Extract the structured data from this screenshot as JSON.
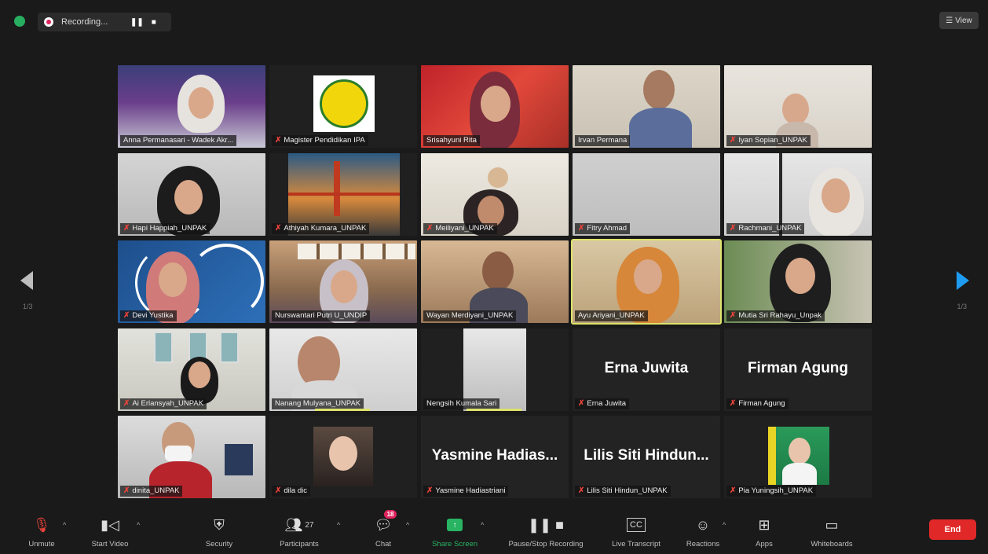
{
  "topbar": {
    "recording_label": "Recording...",
    "pause_glyph": "❚❚",
    "stop_glyph": "■",
    "view_label": "View"
  },
  "nav": {
    "page_left": "1/3",
    "page_right": "1/3"
  },
  "participants": [
    {
      "name": "Anna Permanasari - Wadek Akr...",
      "mic_muted": false,
      "kind": "video"
    },
    {
      "name": "Magister Pendidikan IPA",
      "mic_muted": true,
      "kind": "logo"
    },
    {
      "name": "Srisahyuni Rita",
      "mic_muted": false,
      "kind": "video"
    },
    {
      "name": "Irvan Permana",
      "mic_muted": false,
      "kind": "video"
    },
    {
      "name": "Iyan Sopian_UNPAK",
      "mic_muted": true,
      "kind": "video"
    },
    {
      "name": "Hapi Happiah_UNPAK",
      "mic_muted": true,
      "kind": "video"
    },
    {
      "name": "Athiyah Kumara_UNPAK",
      "mic_muted": true,
      "kind": "image"
    },
    {
      "name": "Meiliyani_UNPAK",
      "mic_muted": true,
      "kind": "video"
    },
    {
      "name": "Fitry Ahmad",
      "mic_muted": true,
      "kind": "blank"
    },
    {
      "name": "Rachmani_UNPAK",
      "mic_muted": true,
      "kind": "video"
    },
    {
      "name": "Devi Yustika",
      "mic_muted": true,
      "kind": "video"
    },
    {
      "name": "Nurswantari Putri U_UNDIP",
      "mic_muted": false,
      "kind": "video"
    },
    {
      "name": "Wayan Merdiyani_UNPAK",
      "mic_muted": false,
      "kind": "video"
    },
    {
      "name": "Ayu Ariyani_UNPAK",
      "mic_muted": false,
      "kind": "video",
      "active": true
    },
    {
      "name": "Mutia Sri Rahayu_Unpak",
      "mic_muted": true,
      "kind": "video"
    },
    {
      "name": "Ai Erlansyah_UNPAK",
      "mic_muted": true,
      "kind": "video"
    },
    {
      "name": "Nanang Mulyana_UNPAK",
      "mic_muted": false,
      "kind": "video"
    },
    {
      "name": "Nengsih Kumala Sari",
      "mic_muted": false,
      "kind": "video"
    },
    {
      "name": "Erna Juwita",
      "mic_muted": true,
      "kind": "text",
      "display": "Erna Juwita"
    },
    {
      "name": "Firman Agung",
      "mic_muted": true,
      "kind": "text",
      "display": "Firman Agung"
    },
    {
      "name": "dinita_UNPAK",
      "mic_muted": true,
      "kind": "video"
    },
    {
      "name": "dila dic",
      "mic_muted": true,
      "kind": "image"
    },
    {
      "name": "Yasmine Hadiastriani",
      "mic_muted": true,
      "kind": "text",
      "display": "Yasmine  Hadias..."
    },
    {
      "name": "Lilis Siti Hindun_UNPAK",
      "mic_muted": true,
      "kind": "text",
      "display": "Lilis Siti Hindun..."
    },
    {
      "name": "Pia Yuningsih_UNPAK",
      "mic_muted": true,
      "kind": "image"
    }
  ],
  "toolbar": {
    "unmute": "Unmute",
    "start_video": "Start Video",
    "security": "Security",
    "participants": "Participants",
    "participants_count": "27",
    "chat": "Chat",
    "chat_badge": "18",
    "share_screen": "Share Screen",
    "pause_stop_recording": "Pause/Stop Recording",
    "live_transcript": "Live Transcript",
    "reactions": "Reactions",
    "apps": "Apps",
    "whiteboards": "Whiteboards",
    "end": "End"
  },
  "colors": {
    "background": "#1a1a1a",
    "tile": "#232323",
    "share_green": "#28b463",
    "end_red": "#e02828",
    "active_speaker": "#dde36a",
    "next_arrow": "#1e9cf2"
  }
}
